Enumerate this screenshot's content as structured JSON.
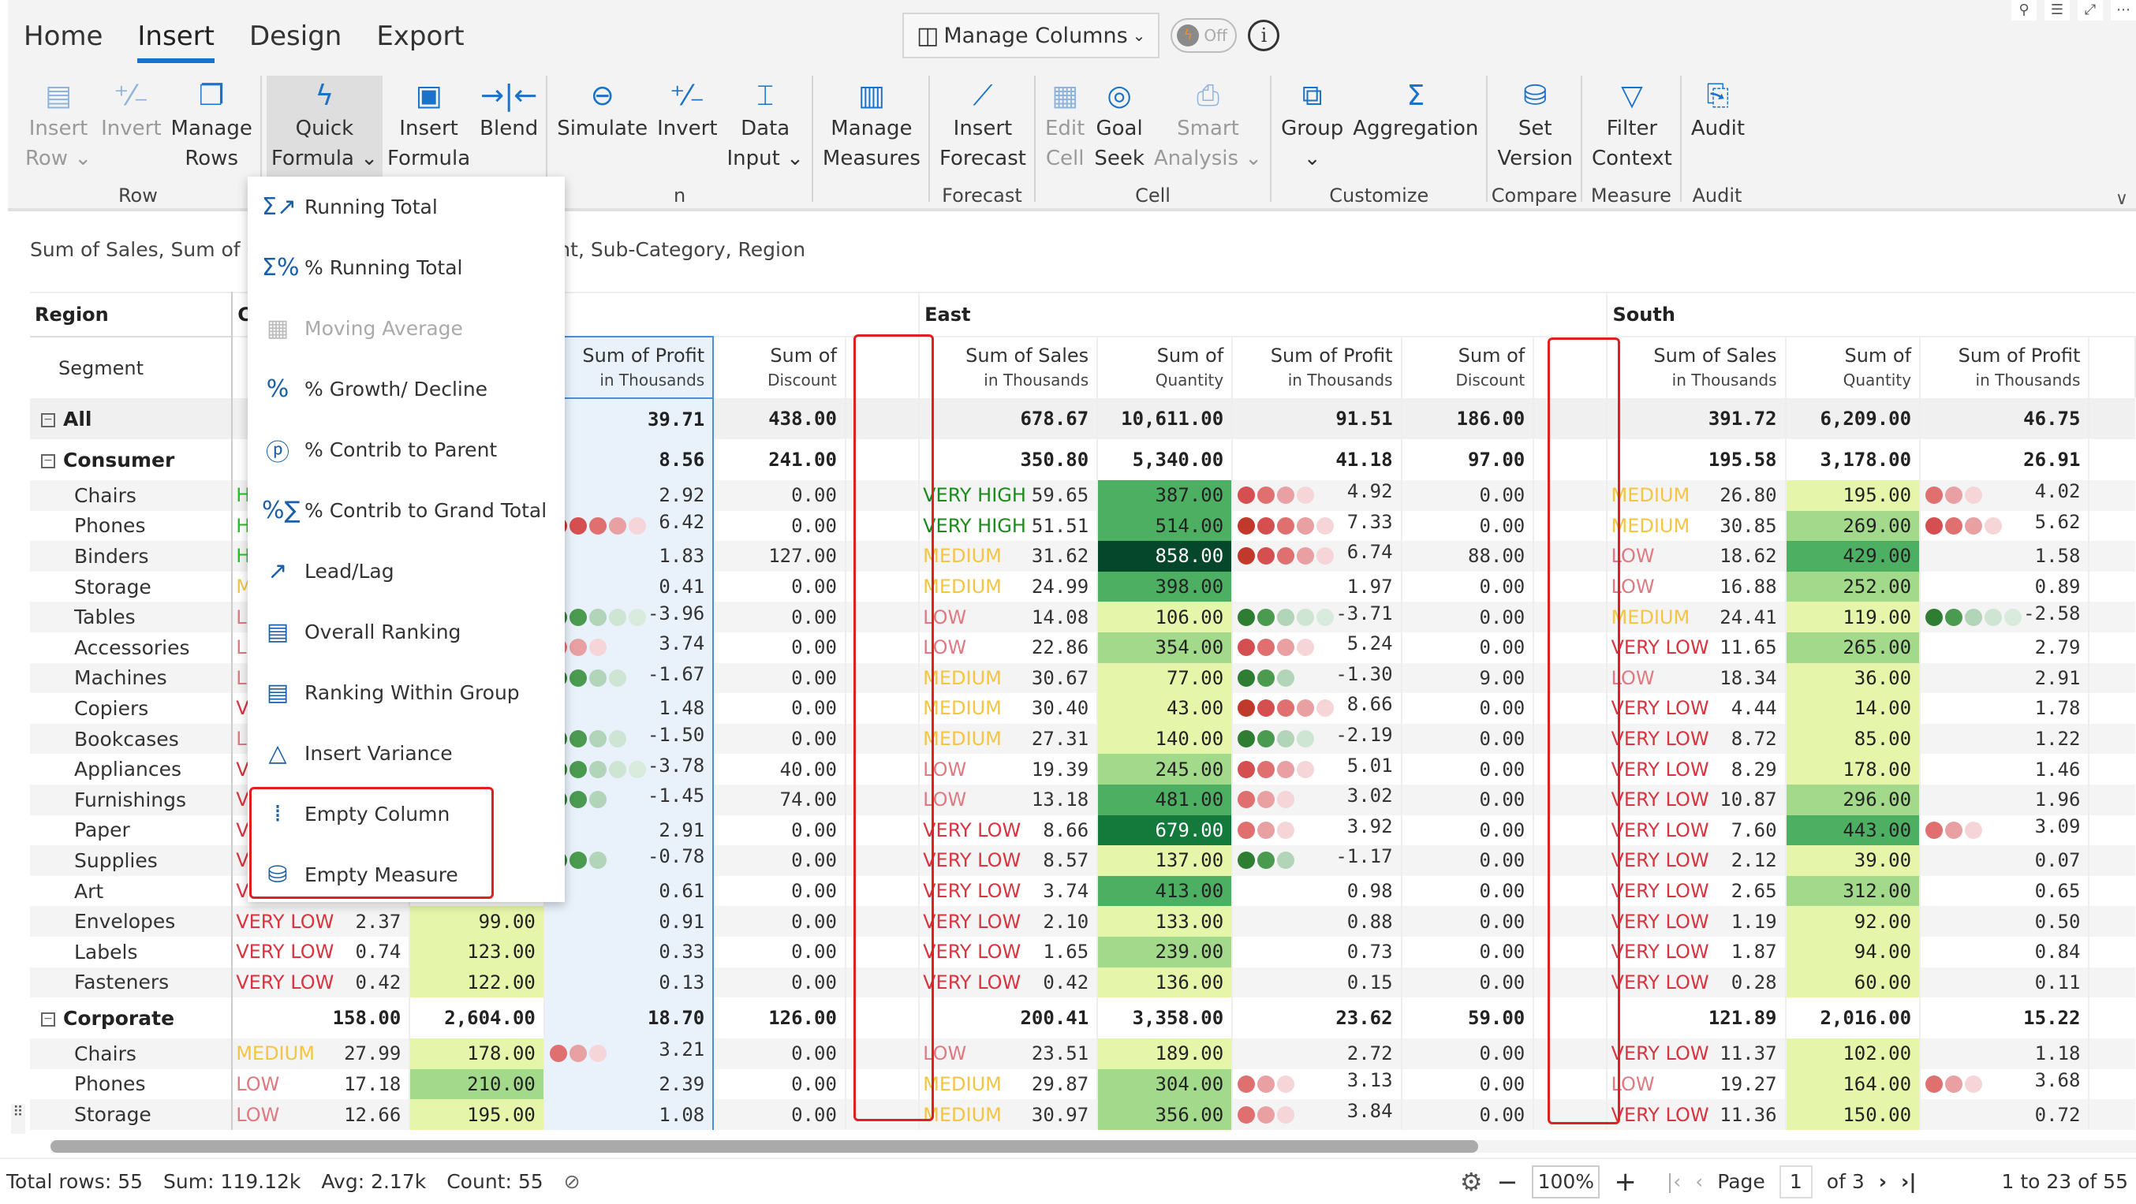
{
  "ribbon": {
    "tabs": [
      {
        "label": "Home"
      },
      {
        "label": "Insert",
        "active": true
      },
      {
        "label": "Design"
      },
      {
        "label": "Export"
      }
    ],
    "manage_columns": "Manage Columns",
    "toggle_label": "Off",
    "info_icon": "i",
    "groups": [
      {
        "label": "Row",
        "buttons": [
          {
            "l1": "Insert",
            "l2": "Row ⌄",
            "icon": "insert-row-icon",
            "disabled": true
          },
          {
            "l1": "Invert",
            "l2": "",
            "icon": "invert-icon",
            "disabled": true
          },
          {
            "l1": "Manage",
            "l2": "Rows",
            "icon": "manage-rows-icon"
          }
        ]
      },
      {
        "label": "",
        "buttons": [
          {
            "l1": "Quick",
            "l2": "Formula ⌄",
            "icon": "lightning-icon",
            "selected": true
          },
          {
            "l1": "Insert",
            "l2": "Formula",
            "icon": "calculator-icon"
          },
          {
            "l1": "Blend",
            "l2": "",
            "icon": "blend-icon"
          }
        ]
      },
      {
        "label": "n",
        "buttons": [
          {
            "l1": "Simulate",
            "l2": "",
            "icon": "simulate-icon"
          },
          {
            "l1": "Invert",
            "l2": "",
            "icon": "invert-icon"
          },
          {
            "l1": "Data",
            "l2": "Input ⌄",
            "icon": "data-input-icon"
          }
        ]
      },
      {
        "label": "",
        "buttons": [
          {
            "l1": "Manage",
            "l2": "Measures",
            "icon": "manage-measures-icon"
          }
        ]
      },
      {
        "label": "Forecast",
        "buttons": [
          {
            "l1": "Insert",
            "l2": "Forecast",
            "icon": "forecast-chart-icon"
          }
        ]
      },
      {
        "label": "Cell",
        "buttons": [
          {
            "l1": "Edit",
            "l2": "Cell",
            "icon": "edit-cell-icon",
            "disabled": true
          },
          {
            "l1": "Goal",
            "l2": "Seek",
            "icon": "goal-seek-icon"
          },
          {
            "l1": "Smart",
            "l2": "Analysis ⌄",
            "icon": "smart-analysis-icon",
            "disabled": true
          }
        ]
      },
      {
        "label": "Customize",
        "buttons": [
          {
            "l1": "Group",
            "l2": "⌄",
            "icon": "group-icon"
          },
          {
            "l1": "Aggregation",
            "l2": "",
            "icon": "sigma-icon"
          }
        ]
      },
      {
        "label": "Compare",
        "buttons": [
          {
            "l1": "Set",
            "l2": "Version",
            "icon": "set-version-icon"
          }
        ]
      },
      {
        "label": "Measure",
        "buttons": [
          {
            "l1": "Filter",
            "l2": "Context",
            "icon": "filter-icon"
          }
        ]
      },
      {
        "label": "Audit",
        "buttons": [
          {
            "l1": "Audit",
            "l2": "",
            "icon": "audit-icon"
          }
        ]
      }
    ]
  },
  "subtitle_left": "Sum of Sales, Sum of Qu",
  "subtitle_right": "t by Segment, Sub-Category, Region",
  "quick_formula_menu": [
    {
      "label": "Running Total",
      "icon": "running-total-icon",
      "glyph": "Σ↗"
    },
    {
      "label": "% Running Total",
      "icon": "percent-running-total-icon",
      "glyph": "Σ%"
    },
    {
      "label": "Moving Average",
      "icon": "moving-average-icon",
      "glyph": "▦",
      "disabled": true
    },
    {
      "label": "% Growth/ Decline",
      "icon": "percent-icon",
      "glyph": "%"
    },
    {
      "label": "% Contrib to Parent",
      "icon": "percent-circle-icon",
      "glyph": "ⓟ"
    },
    {
      "label": "% Contrib to Grand Total",
      "icon": "percent-sigma-icon",
      "glyph": "%∑"
    },
    {
      "label": "Lead/Lag",
      "icon": "lead-lag-icon",
      "glyph": "↗"
    },
    {
      "label": "Overall Ranking",
      "icon": "overall-ranking-icon",
      "glyph": "▤"
    },
    {
      "label": "Ranking Within Group",
      "icon": "ranking-group-icon",
      "glyph": "▤"
    },
    {
      "label": "Insert Variance",
      "icon": "triangle-icon",
      "glyph": "△"
    },
    {
      "label": "Empty Column",
      "icon": "empty-column-icon",
      "glyph": "⁞"
    },
    {
      "label": "Empty Measure",
      "icon": "empty-measure-icon",
      "glyph": "⛁"
    }
  ],
  "grid": {
    "row_header": "Region",
    "segment_header": "Segment",
    "central_partial": "C",
    "regions": [
      "East",
      "South"
    ],
    "measure_headers": [
      {
        "l1": "Sum of Profit",
        "l2": "in Thousands"
      },
      {
        "l1": "Sum of",
        "l2": "Discount"
      },
      {
        "l1": "Sum of Sales",
        "l2": "in Thousands"
      },
      {
        "l1": "Sum of",
        "l2": "Quantity"
      },
      {
        "l1": "Sum of Profit",
        "l2": "in Thousands"
      },
      {
        "l1": "Sum of",
        "l2": "Discount"
      },
      {
        "l1": "Sum of Sales",
        "l2": "in Thousands"
      },
      {
        "l1": "Sum of",
        "l2": "Quantity"
      },
      {
        "l1": "Sum of Profit",
        "l2": "in Thousands"
      }
    ],
    "rows": [
      {
        "label": "All",
        "level": 0,
        "c_lbl": "",
        "c_sales": "",
        "c_qty": "",
        "c_profit": "39.71",
        "c_disc": "438.00",
        "e_lbl": "",
        "e_sales": "678.67",
        "e_qty": "10,611.00",
        "e_profit": "91.51",
        "e_disc": "186.00",
        "s_lbl": "",
        "s_sales": "391.72",
        "s_qty": "6,209.00",
        "s_profit": "46.75"
      },
      {
        "label": "Consumer",
        "level": 0,
        "c_profit": "8.56",
        "c_disc": "241.00",
        "e_sales": "350.80",
        "e_qty": "5,340.00",
        "e_profit": "41.18",
        "e_disc": "97.00",
        "s_sales": "195.58",
        "s_qty": "3,178.00",
        "s_profit": "26.91"
      },
      {
        "label": "Chairs",
        "c_lbl": "H",
        "c_profit": "2.92",
        "c_disc": "0.00",
        "e_lbl": "VERY HIGH",
        "e_sales": "59.65",
        "e_qty": "387.00",
        "e_profit": "4.92",
        "e_disc": "0.00",
        "s_lbl": "MEDIUM",
        "s_sales": "26.80",
        "s_qty": "195.00",
        "s_profit": "4.02"
      },
      {
        "label": "Phones",
        "c_lbl": "H",
        "c_profit": "6.42",
        "c_disc": "0.00",
        "e_lbl": "VERY HIGH",
        "e_sales": "51.51",
        "e_qty": "514.00",
        "e_profit": "7.33",
        "e_disc": "0.00",
        "s_lbl": "MEDIUM",
        "s_sales": "30.85",
        "s_qty": "269.00",
        "s_profit": "5.62"
      },
      {
        "label": "Binders",
        "c_lbl": "H",
        "c_profit": "1.83",
        "c_disc": "127.00",
        "e_lbl": "MEDIUM",
        "e_sales": "31.62",
        "e_qty": "858.00",
        "e_profit": "6.74",
        "e_disc": "88.00",
        "s_lbl": "LOW",
        "s_sales": "18.62",
        "s_qty": "429.00",
        "s_profit": "1.58"
      },
      {
        "label": "Storage",
        "c_lbl": "M",
        "c_profit": "0.41",
        "c_disc": "0.00",
        "e_lbl": "MEDIUM",
        "e_sales": "24.99",
        "e_qty": "398.00",
        "e_profit": "1.97",
        "e_disc": "0.00",
        "s_lbl": "LOW",
        "s_sales": "16.88",
        "s_qty": "252.00",
        "s_profit": "0.89"
      },
      {
        "label": "Tables",
        "c_lbl": "L",
        "c_profit": "-3.96",
        "c_disc": "0.00",
        "e_lbl": "LOW",
        "e_sales": "14.08",
        "e_qty": "106.00",
        "e_profit": "-3.71",
        "e_disc": "0.00",
        "s_lbl": "MEDIUM",
        "s_sales": "24.41",
        "s_qty": "119.00",
        "s_profit": "-2.58"
      },
      {
        "label": "Accessories",
        "c_lbl": "L",
        "c_profit": "3.74",
        "c_disc": "0.00",
        "e_lbl": "LOW",
        "e_sales": "22.86",
        "e_qty": "354.00",
        "e_profit": "5.24",
        "e_disc": "0.00",
        "s_lbl": "VERY LOW",
        "s_sales": "11.65",
        "s_qty": "265.00",
        "s_profit": "2.79"
      },
      {
        "label": "Machines",
        "c_lbl": "L",
        "c_profit": "-1.67",
        "c_disc": "0.00",
        "e_lbl": "MEDIUM",
        "e_sales": "30.67",
        "e_qty": "77.00",
        "e_profit": "-1.30",
        "e_disc": "9.00",
        "s_lbl": "LOW",
        "s_sales": "18.34",
        "s_qty": "36.00",
        "s_profit": "2.91"
      },
      {
        "label": "Copiers",
        "c_lbl": "V",
        "c_profit": "1.48",
        "c_disc": "0.00",
        "e_lbl": "MEDIUM",
        "e_sales": "30.40",
        "e_qty": "43.00",
        "e_profit": "8.66",
        "e_disc": "0.00",
        "s_lbl": "VERY LOW",
        "s_sales": "4.44",
        "s_qty": "14.00",
        "s_profit": "1.78"
      },
      {
        "label": "Bookcases",
        "c_lbl": "L",
        "c_profit": "-1.50",
        "c_disc": "0.00",
        "e_lbl": "MEDIUM",
        "e_sales": "27.31",
        "e_qty": "140.00",
        "e_profit": "-2.19",
        "e_disc": "0.00",
        "s_lbl": "VERY LOW",
        "s_sales": "8.72",
        "s_qty": "85.00",
        "s_profit": "1.22"
      },
      {
        "label": "Appliances",
        "c_lbl": "V",
        "c_profit": "-3.78",
        "c_disc": "40.00",
        "e_lbl": "LOW",
        "e_sales": "19.39",
        "e_qty": "245.00",
        "e_profit": "5.01",
        "e_disc": "0.00",
        "s_lbl": "VERY LOW",
        "s_sales": "8.29",
        "s_qty": "178.00",
        "s_profit": "1.46"
      },
      {
        "label": "Furnishings",
        "c_lbl": "V",
        "c_profit": "-1.45",
        "c_disc": "74.00",
        "e_lbl": "LOW",
        "e_sales": "13.18",
        "e_qty": "481.00",
        "e_profit": "3.02",
        "e_disc": "0.00",
        "s_lbl": "VERY LOW",
        "s_sales": "10.87",
        "s_qty": "296.00",
        "s_profit": "1.96"
      },
      {
        "label": "Paper",
        "c_lbl": "V",
        "c_profit": "2.91",
        "c_disc": "0.00",
        "e_lbl": "VERY LOW",
        "e_sales": "8.66",
        "e_qty": "679.00",
        "e_profit": "3.92",
        "e_disc": "0.00",
        "s_lbl": "VERY LOW",
        "s_sales": "7.60",
        "s_qty": "443.00",
        "s_profit": "3.09"
      },
      {
        "label": "Supplies",
        "c_lbl": "V",
        "c_profit": "-0.78",
        "c_disc": "0.00",
        "e_lbl": "VERY LOW",
        "e_sales": "8.57",
        "e_qty": "137.00",
        "e_profit": "-1.17",
        "e_disc": "0.00",
        "s_lbl": "VERY LOW",
        "s_sales": "2.12",
        "s_qty": "39.00",
        "s_profit": "0.07"
      },
      {
        "label": "Art",
        "c_lbl": "V",
        "c_profit": "0.61",
        "c_disc": "0.00",
        "e_lbl": "VERY LOW",
        "e_sales": "3.74",
        "e_qty": "413.00",
        "e_profit": "0.98",
        "e_disc": "0.00",
        "s_lbl": "VERY LOW",
        "s_sales": "2.65",
        "s_qty": "312.00",
        "s_profit": "0.65"
      },
      {
        "label": "Envelopes",
        "c_lbl": "VERY LOW",
        "c_sales": "2.37",
        "c_qty": "99.00",
        "c_profit": "0.91",
        "c_disc": "0.00",
        "e_lbl": "VERY LOW",
        "e_sales": "2.10",
        "e_qty": "133.00",
        "e_profit": "0.88",
        "e_disc": "0.00",
        "s_lbl": "VERY LOW",
        "s_sales": "1.19",
        "s_qty": "92.00",
        "s_profit": "0.50"
      },
      {
        "label": "Labels",
        "c_lbl": "VERY LOW",
        "c_sales": "0.74",
        "c_qty": "123.00",
        "c_profit": "0.33",
        "c_disc": "0.00",
        "e_lbl": "VERY LOW",
        "e_sales": "1.65",
        "e_qty": "239.00",
        "e_profit": "0.73",
        "e_disc": "0.00",
        "s_lbl": "VERY LOW",
        "s_sales": "1.87",
        "s_qty": "94.00",
        "s_profit": "0.84"
      },
      {
        "label": "Fasteners",
        "c_lbl": "VERY LOW",
        "c_sales": "0.42",
        "c_qty": "122.00",
        "c_profit": "0.13",
        "c_disc": "0.00",
        "e_lbl": "VERY LOW",
        "e_sales": "0.42",
        "e_qty": "136.00",
        "e_profit": "0.15",
        "e_disc": "0.00",
        "s_lbl": "VERY LOW",
        "s_sales": "0.28",
        "s_qty": "60.00",
        "s_profit": "0.11"
      },
      {
        "label": "Corporate",
        "level": 0,
        "c_sales": "158.00",
        "c_qty": "2,604.00",
        "c_profit": "18.70",
        "c_disc": "126.00",
        "e_sales": "200.41",
        "e_qty": "3,358.00",
        "e_profit": "23.62",
        "e_disc": "59.00",
        "s_sales": "121.89",
        "s_qty": "2,016.00",
        "s_profit": "15.22"
      },
      {
        "label": "Chairs",
        "c_lbl": "MEDIUM",
        "c_sales": "27.99",
        "c_qty": "178.00",
        "c_profit": "3.21",
        "c_disc": "0.00",
        "e_lbl": "LOW",
        "e_sales": "23.51",
        "e_qty": "189.00",
        "e_profit": "2.72",
        "e_disc": "0.00",
        "s_lbl": "VERY LOW",
        "s_sales": "11.37",
        "s_qty": "102.00",
        "s_profit": "1.18"
      },
      {
        "label": "Phones",
        "c_lbl": "LOW",
        "c_sales": "17.18",
        "c_qty": "210.00",
        "c_profit": "2.39",
        "c_disc": "0.00",
        "e_lbl": "MEDIUM",
        "e_sales": "29.87",
        "e_qty": "304.00",
        "e_profit": "3.13",
        "e_disc": "0.00",
        "s_lbl": "LOW",
        "s_sales": "19.27",
        "s_qty": "164.00",
        "s_profit": "3.68"
      },
      {
        "label": "Storage",
        "c_lbl": "LOW",
        "c_sales": "12.66",
        "c_qty": "195.00",
        "c_profit": "1.08",
        "c_disc": "0.00",
        "e_lbl": "MEDIUM",
        "e_sales": "30.97",
        "e_qty": "356.00",
        "e_profit": "3.84",
        "e_disc": "0.00",
        "s_lbl": "VERY LOW",
        "s_sales": "11.36",
        "s_qty": "150.00",
        "s_profit": "0.72"
      }
    ]
  },
  "colors": {
    "VERY HIGH": "#1a8c1a",
    "HIGH": "#22c322",
    "MEDIUM": "#f5c542",
    "LOW": "#e07a80",
    "VERY LOW": "#d9343f",
    "accent": "#1a73c9",
    "highlight_box": "#e02020"
  },
  "status": {
    "total_rows": "Total rows: 55",
    "sum": "Sum: 119.12k",
    "avg": "Avg: 2.17k",
    "count": "Count: 55",
    "zoom": "100%",
    "page_label": "Page",
    "page": "1",
    "of_pages": "of 3",
    "range": "1 to 23 of 55"
  }
}
